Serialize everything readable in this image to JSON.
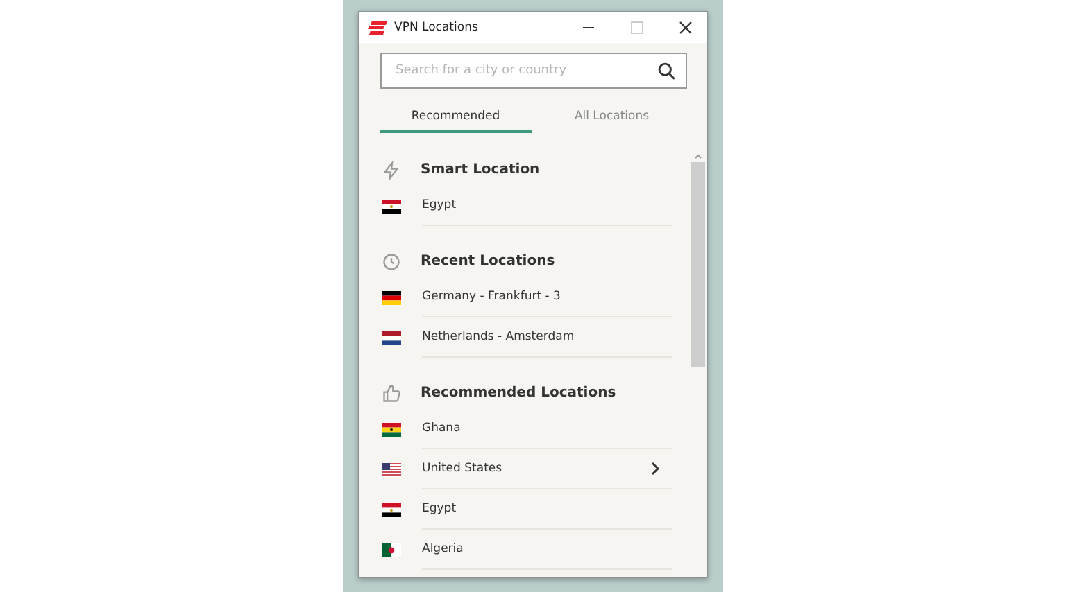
{
  "window": {
    "title": "VPN Locations"
  },
  "search": {
    "placeholder": "Search for a city or country"
  },
  "tabs": [
    {
      "label": "Recommended",
      "selected": true
    },
    {
      "label": "All Locations",
      "selected": false
    }
  ],
  "sections": [
    {
      "kind": "smart",
      "title": "Smart Location",
      "items": [
        {
          "name": "Egypt",
          "kind": "eg",
          "expandable": false
        }
      ]
    },
    {
      "kind": "recent",
      "title": "Recent Locations",
      "items": [
        {
          "name": "Germany - Frankfurt - 3",
          "kind": "de",
          "expandable": false
        },
        {
          "name": "Netherlands - Amsterdam",
          "kind": "nl",
          "expandable": false
        }
      ]
    },
    {
      "kind": "recommended",
      "title": "Recommended Locations",
      "items": [
        {
          "name": "Ghana",
          "kind": "gh",
          "expandable": false
        },
        {
          "name": "United States",
          "kind": "us",
          "expandable": true
        },
        {
          "name": "Egypt",
          "kind": "eg",
          "expandable": false
        },
        {
          "name": "Algeria",
          "kind": "dz",
          "expandable": false
        }
      ]
    }
  ]
}
